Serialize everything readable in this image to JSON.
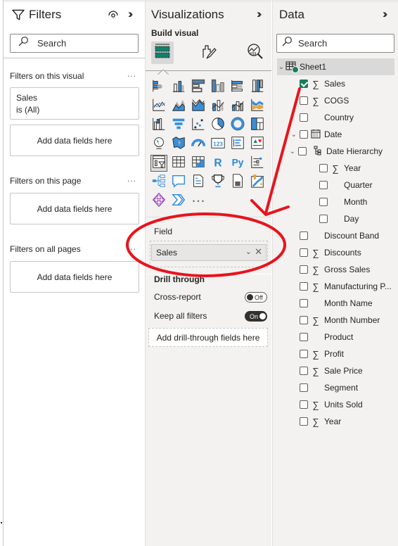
{
  "filters": {
    "title": "Filters",
    "search_placeholder": "Search",
    "sections": [
      {
        "label": "Filters on this visual",
        "more": "...",
        "filter_card": {
          "field": "Sales",
          "condition": "is (All)"
        },
        "drop_text": "Add data fields here"
      },
      {
        "label": "Filters on this page",
        "more": "...",
        "drop_text": "Add data fields here"
      },
      {
        "label": "Filters on all pages",
        "more": "...",
        "drop_text": "Add data fields here"
      }
    ]
  },
  "visualizations": {
    "title": "Visualizations",
    "subtitle": "Build visual",
    "build_tabs": [
      {
        "name": "build-visual",
        "active": true
      },
      {
        "name": "format-visual",
        "active": false
      },
      {
        "name": "analytics",
        "active": false
      }
    ],
    "icons": [
      "stacked-bar-chart",
      "stacked-column-chart",
      "clustered-bar-chart",
      "clustered-column-chart",
      "100-stacked-bar-chart",
      "100-stacked-column-chart",
      "line-chart",
      "area-chart",
      "stacked-area-chart",
      "line-and-stacked-column-chart",
      "line-and-clustered-column-chart",
      "ribbon-chart",
      "waterfall-chart",
      "funnel-chart",
      "scatter-chart",
      "pie-chart",
      "donut-chart",
      "treemap",
      "map",
      "filled-map",
      "gauge",
      "card",
      "multi-row-card",
      "kpi",
      "slicer",
      "table",
      "matrix",
      "r-script-visual",
      "python-visual",
      "key-influencers",
      "decomposition-tree",
      "qa",
      "smart-narrative",
      "goals",
      "paginated-report",
      "azure-map",
      "power-apps",
      "power-automate",
      "more-visuals"
    ],
    "field_section": {
      "label": "Field",
      "value": "Sales"
    },
    "drill_through": {
      "title": "Drill through",
      "cross_report": {
        "label": "Cross-report",
        "state": "Off"
      },
      "keep_all_filters": {
        "label": "Keep all filters",
        "state": "On"
      },
      "drop_text": "Add drill-through fields here"
    }
  },
  "data": {
    "title": "Data",
    "search_placeholder": "Search",
    "table": {
      "name": "Sheet1",
      "expanded": true
    },
    "fields": [
      {
        "label": "Sales",
        "sigma": true,
        "checked": true,
        "indent": 1
      },
      {
        "label": "COGS",
        "sigma": true,
        "checked": false,
        "indent": 1
      },
      {
        "label": "Country",
        "sigma": false,
        "checked": false,
        "indent": 1
      },
      {
        "label": "Date",
        "sigma": false,
        "checked": false,
        "indent": 1,
        "type": "date",
        "expanded": true
      },
      {
        "label": "Date Hierarchy",
        "sigma": false,
        "checked": false,
        "indent": 2,
        "type": "hierarchy",
        "expanded": true
      },
      {
        "label": "Year",
        "sigma": true,
        "checked": false,
        "indent": 3
      },
      {
        "label": "Quarter",
        "sigma": false,
        "checked": false,
        "indent": 3
      },
      {
        "label": "Month",
        "sigma": false,
        "checked": false,
        "indent": 3
      },
      {
        "label": "Day",
        "sigma": false,
        "checked": false,
        "indent": 3
      },
      {
        "label": "Discount Band",
        "sigma": false,
        "checked": false,
        "indent": 1
      },
      {
        "label": "Discounts",
        "sigma": true,
        "checked": false,
        "indent": 1
      },
      {
        "label": "Gross Sales",
        "sigma": true,
        "checked": false,
        "indent": 1
      },
      {
        "label": "Manufacturing P...",
        "sigma": true,
        "checked": false,
        "indent": 1
      },
      {
        "label": "Month Name",
        "sigma": false,
        "checked": false,
        "indent": 1
      },
      {
        "label": "Month Number",
        "sigma": true,
        "checked": false,
        "indent": 1
      },
      {
        "label": "Product",
        "sigma": false,
        "checked": false,
        "indent": 1
      },
      {
        "label": "Profit",
        "sigma": true,
        "checked": false,
        "indent": 1
      },
      {
        "label": "Sale Price",
        "sigma": true,
        "checked": false,
        "indent": 1
      },
      {
        "label": "Segment",
        "sigma": false,
        "checked": false,
        "indent": 1
      },
      {
        "label": "Units Sold",
        "sigma": true,
        "checked": false,
        "indent": 1
      },
      {
        "label": "Year",
        "sigma": true,
        "checked": false,
        "indent": 1
      }
    ]
  },
  "annotation": {
    "color": "#e8141c"
  },
  "colors": {
    "accent_green": "#1a7a5e",
    "viz_blue": "#3a8fd9"
  }
}
